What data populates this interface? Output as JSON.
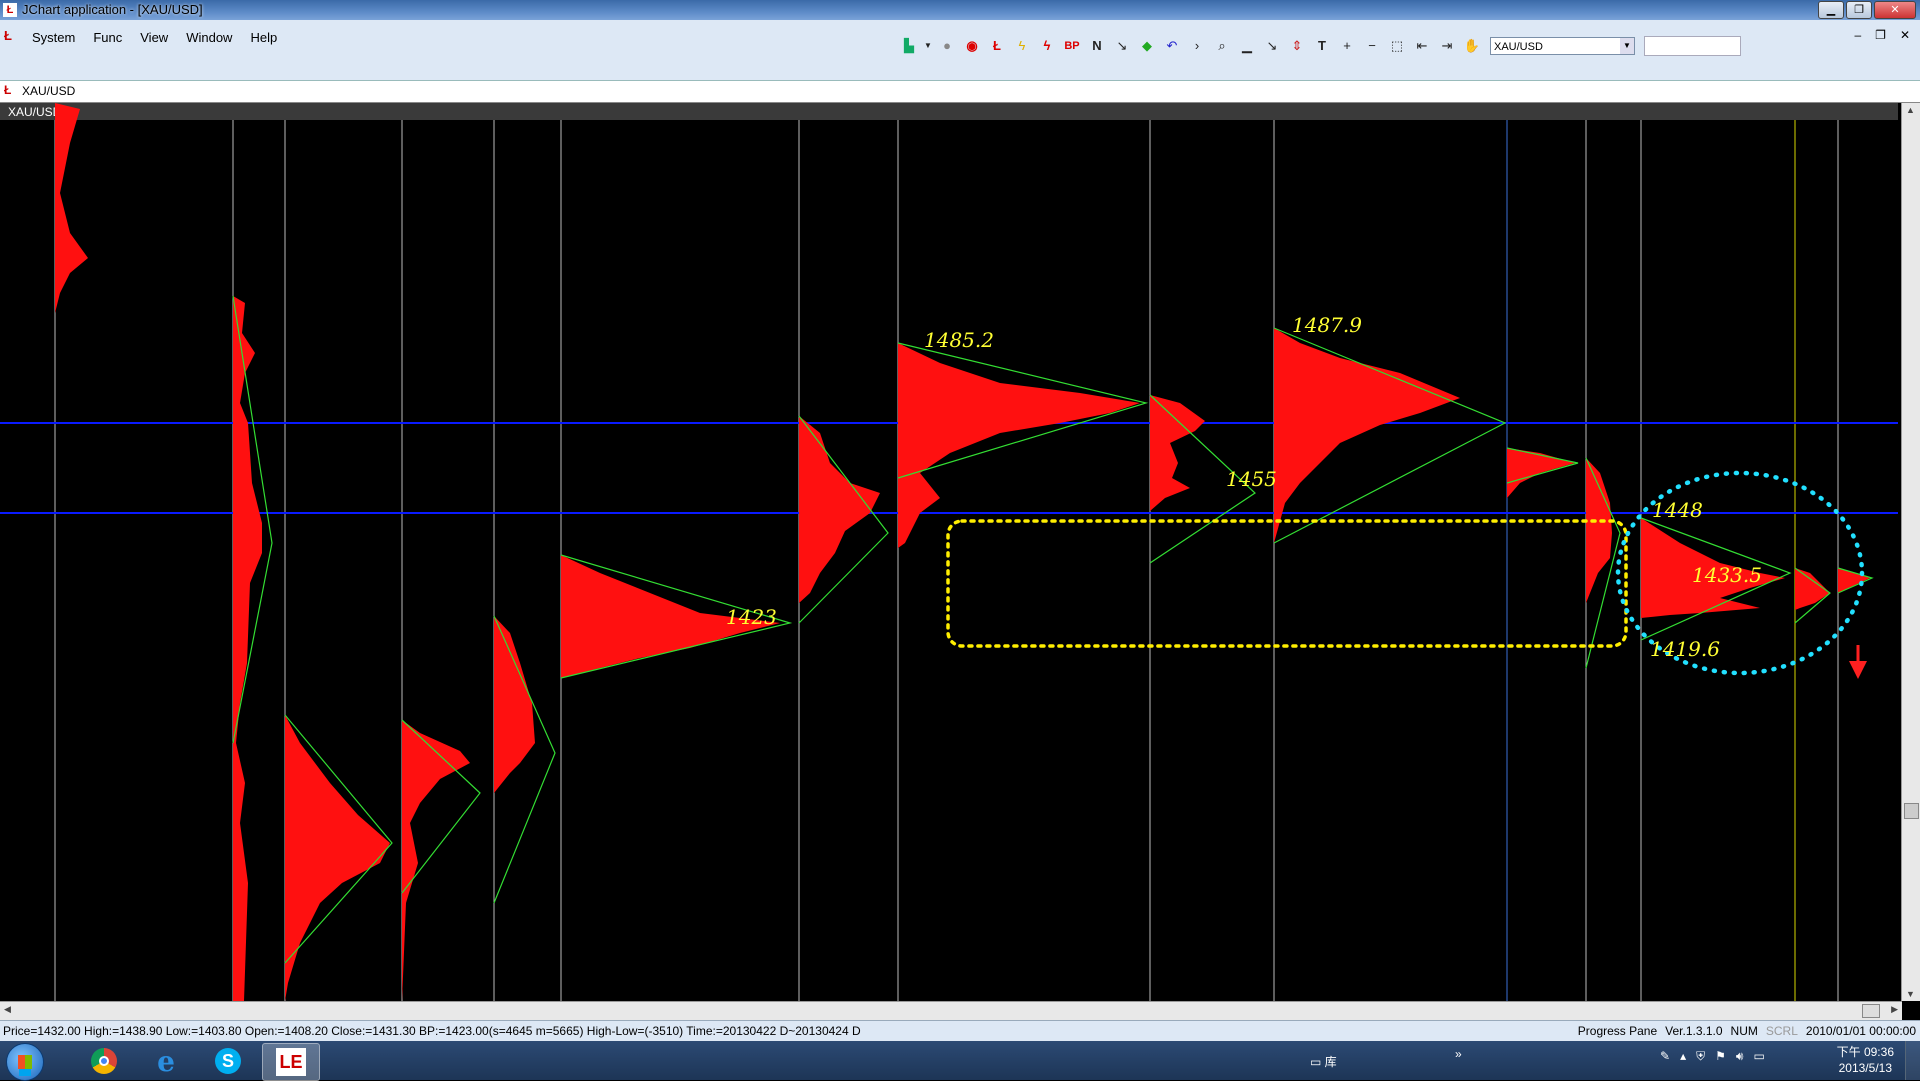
{
  "window": {
    "title": "JChart application - [XAU/USD]",
    "app_icon": "jchart-logo-icon"
  },
  "menu": {
    "items": [
      "System",
      "Func",
      "View",
      "Window",
      "Help"
    ]
  },
  "toolbar": {
    "buttons": [
      "bar-chart-icon",
      "dropdown-arrow-icon",
      "circle-icon",
      "record-icon",
      "jchart-logo-icon",
      "lightning-icon",
      "lightning-red-icon",
      "bp-icon",
      "n-icon",
      "n-alt-icon",
      "cube-icon",
      "undo-icon",
      "forward-icon",
      "zoom-icon",
      "line-icon",
      "diagonal-line-icon",
      "arrow-icon",
      "text-tool-icon",
      "plus-icon",
      "minus-icon",
      "select-rect-icon",
      "scroll-left-icon",
      "scroll-right-icon",
      "hand-icon"
    ],
    "bp_label": "BP",
    "n_label": "N",
    "t_label": "T",
    "symbol_value": "XAU/USD"
  },
  "address": {
    "symbol": "XAU/USD"
  },
  "chart": {
    "pane_label": "XAU/USD",
    "annotations": [
      "1485.2",
      "1487.9",
      "1423",
      "1455",
      "1448",
      "1433.5",
      "1419.6"
    ],
    "colors": {
      "background": "#000000",
      "profile": "#ff0000",
      "trend_line": "#00cc00",
      "level_line": "#0000ff",
      "price_label": "#ffff00",
      "highlight_box": "#ffff00",
      "circle": "#00e5ff",
      "arrow": "#ff0000"
    }
  },
  "chart_data": {
    "type": "market-profile",
    "instrument": "XAU/USD",
    "labeled_levels": [
      {
        "label": "1485.2",
        "value": 1485.2
      },
      {
        "label": "1487.9",
        "value": 1487.9
      },
      {
        "label": "1423",
        "value": 1423
      },
      {
        "label": "1455",
        "value": 1455
      },
      {
        "label": "1448",
        "value": 1448
      },
      {
        "label": "1433.5",
        "value": 1433.5
      },
      {
        "label": "1419.6",
        "value": 1419.6
      }
    ]
  },
  "status": {
    "left": "Price=1432.00  High:=1438.90  Low:=1403.80  Open:=1408.20  Close:=1431.30  BP:=1423.00(s=4645 m=5665)  High-Low=(-3510)  Time:=20130422 D~20130424 D",
    "pane": "Progress Pane",
    "version": "Ver.1.3.1.0",
    "num": "NUM",
    "scrl": "SCRL",
    "datetime": "2010/01/01 00:00:00"
  },
  "taskbar": {
    "apps": [
      "chrome-icon",
      "internet-explorer-icon",
      "skype-icon",
      "jchart-icon"
    ],
    "ie_glyph": "e",
    "skype_glyph": "S",
    "jchart_glyph": "LE",
    "folder_label": "库",
    "chevron": "»",
    "time": "下午 09:36",
    "date": "2013/5/13"
  }
}
